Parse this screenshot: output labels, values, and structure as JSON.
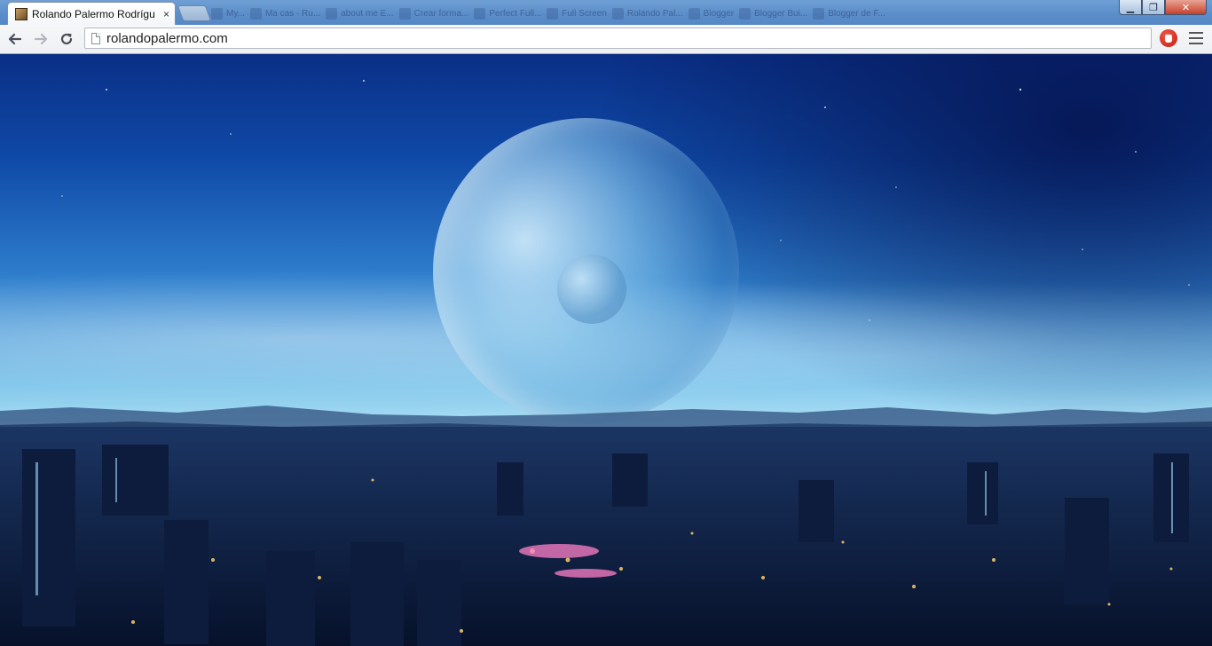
{
  "window": {
    "active_tab": {
      "title": "Rolando Palermo Rodrígu",
      "close": "×"
    },
    "background_tabs": [
      "My...",
      "Ma cas - Ru...",
      "about me E...",
      "Crear forma...",
      "Perfect Full...",
      "Full Screen",
      "Rolando Pal...",
      "Blogger",
      "Blogger Bui...",
      "Blogger de F..."
    ],
    "controls": {
      "minimize": "▁",
      "maximize": "❐",
      "close": "✕"
    }
  },
  "toolbar": {
    "url": "rolandopalermo.com"
  },
  "icons": {
    "back": "arrow-left",
    "forward": "arrow-right",
    "reload": "reload",
    "page": "page",
    "extension": "adblock-hand",
    "menu": "hamburger"
  },
  "colors": {
    "tabstrip": "#5a8cc8",
    "toolbar": "#f1f3f5",
    "sky_top": "#0a2f86",
    "horizon": "#b8e6f6",
    "city_night": "#0a1530",
    "close_button": "#c7402b"
  }
}
